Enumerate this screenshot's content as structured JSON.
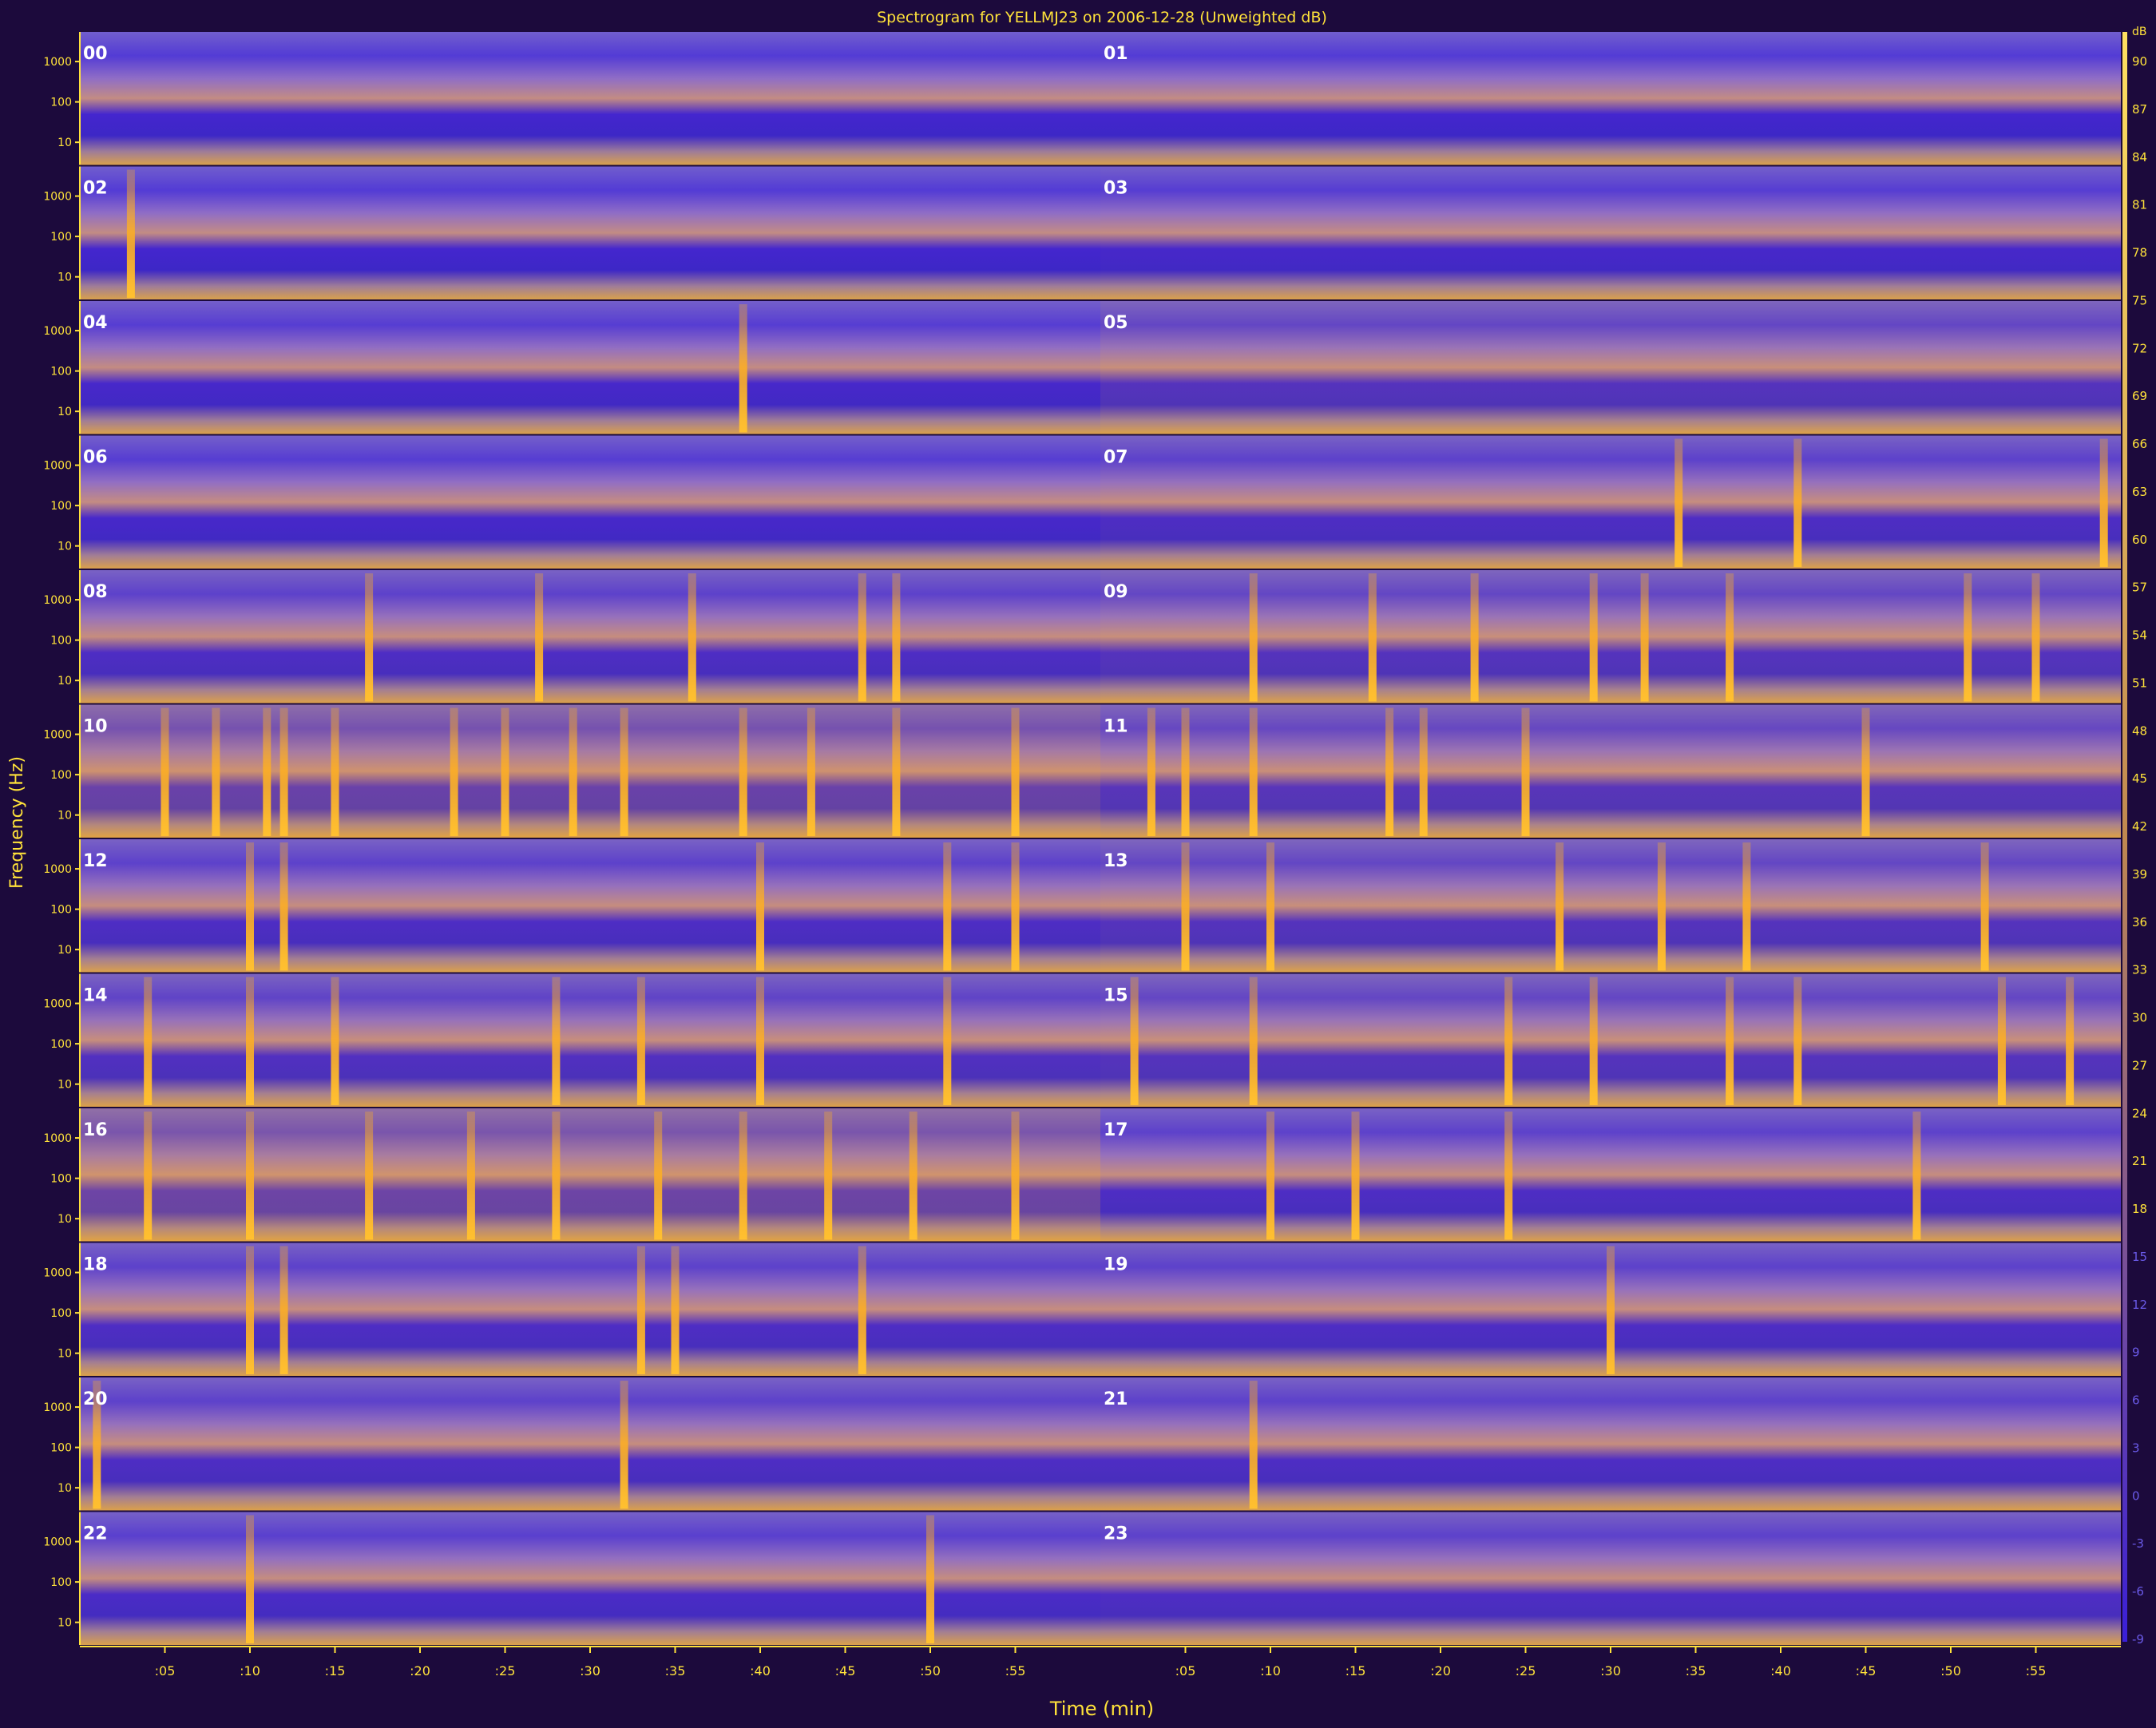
{
  "chart_data": {
    "type": "heatmap",
    "title": "Spectrogram for YELLMJ23 on 2006-12-28 (Unweighted dB)",
    "xlabel": "Time (min)",
    "ylabel": "Frequency (Hz)",
    "x_tick_labels": [
      ":05",
      ":10",
      ":15",
      ":20",
      ":25",
      ":30",
      ":35",
      ":40",
      ":45",
      ":50",
      ":55",
      ":05",
      ":10",
      ":15",
      ":20",
      ":25",
      ":30",
      ":35",
      ":40",
      ":45",
      ":50",
      ":55"
    ],
    "y_tick_labels": [
      "1000",
      "100",
      "10"
    ],
    "colorbar_label": "dB",
    "colorbar_ticks": [
      "90",
      "87",
      "84",
      "81",
      "78",
      "75",
      "72",
      "69",
      "66",
      "63",
      "60",
      "57",
      "54",
      "51",
      "48",
      "45",
      "42",
      "39",
      "36",
      "33",
      "30",
      "27",
      "24",
      "21",
      "18",
      "15",
      "12",
      "9",
      "6",
      "3",
      "0",
      "-3",
      "-6",
      "-9"
    ],
    "hour_labels": [
      "00",
      "01",
      "02",
      "03",
      "04",
      "05",
      "06",
      "07",
      "08",
      "09",
      "10",
      "11",
      "12",
      "13",
      "14",
      "15",
      "16",
      "17",
      "18",
      "19",
      "20",
      "21",
      "22",
      "23"
    ],
    "colors": {
      "background": "#1c0a3c",
      "low": "#3a1fd8",
      "high": "#ffae1a",
      "axis": "#ffe23a",
      "text": "#ffffff"
    },
    "activity": [
      {
        "hour": "00",
        "level": 0.15,
        "events": []
      },
      {
        "hour": "01",
        "level": 0.15,
        "events": []
      },
      {
        "hour": "02",
        "level": 0.15,
        "events": [
          3
        ]
      },
      {
        "hour": "03",
        "level": 0.2,
        "events": []
      },
      {
        "hour": "04",
        "level": 0.2,
        "events": [
          39
        ]
      },
      {
        "hour": "05",
        "level": 0.4,
        "events": []
      },
      {
        "hour": "06",
        "level": 0.2,
        "events": []
      },
      {
        "hour": "07",
        "level": 0.3,
        "events": [
          34,
          41,
          59
        ]
      },
      {
        "hour": "08",
        "level": 0.3,
        "events": [
          17,
          27,
          36,
          46,
          48
        ]
      },
      {
        "hour": "09",
        "level": 0.4,
        "events": [
          9,
          16,
          22,
          29,
          32,
          37,
          51,
          55
        ]
      },
      {
        "hour": "10",
        "level": 0.7,
        "events": [
          5,
          8,
          11,
          12,
          15,
          22,
          25,
          29,
          32,
          39,
          43,
          48,
          55
        ]
      },
      {
        "hour": "11",
        "level": 0.45,
        "events": [
          3,
          5,
          9,
          17,
          19,
          25,
          45
        ]
      },
      {
        "hour": "12",
        "level": 0.3,
        "events": [
          10,
          12,
          40,
          51,
          55
        ]
      },
      {
        "hour": "13",
        "level": 0.4,
        "events": [
          5,
          10,
          27,
          33,
          38,
          52
        ]
      },
      {
        "hour": "14",
        "level": 0.35,
        "events": [
          4,
          10,
          15,
          28,
          33,
          40,
          51
        ]
      },
      {
        "hour": "15",
        "level": 0.4,
        "events": [
          2,
          9,
          24,
          29,
          37,
          41,
          53,
          57
        ]
      },
      {
        "hour": "16",
        "level": 0.75,
        "events": [
          4,
          10,
          17,
          23,
          28,
          34,
          39,
          44,
          49,
          55
        ]
      },
      {
        "hour": "17",
        "level": 0.3,
        "events": [
          10,
          15,
          24,
          48
        ]
      },
      {
        "hour": "18",
        "level": 0.3,
        "events": [
          10,
          12,
          33,
          35,
          46
        ]
      },
      {
        "hour": "19",
        "level": 0.3,
        "events": [
          30
        ]
      },
      {
        "hour": "20",
        "level": 0.3,
        "events": [
          1,
          32
        ]
      },
      {
        "hour": "21",
        "level": 0.3,
        "events": [
          9
        ]
      },
      {
        "hour": "22",
        "level": 0.25,
        "events": [
          10,
          50
        ]
      },
      {
        "hour": "23",
        "level": 0.3,
        "events": []
      }
    ]
  }
}
